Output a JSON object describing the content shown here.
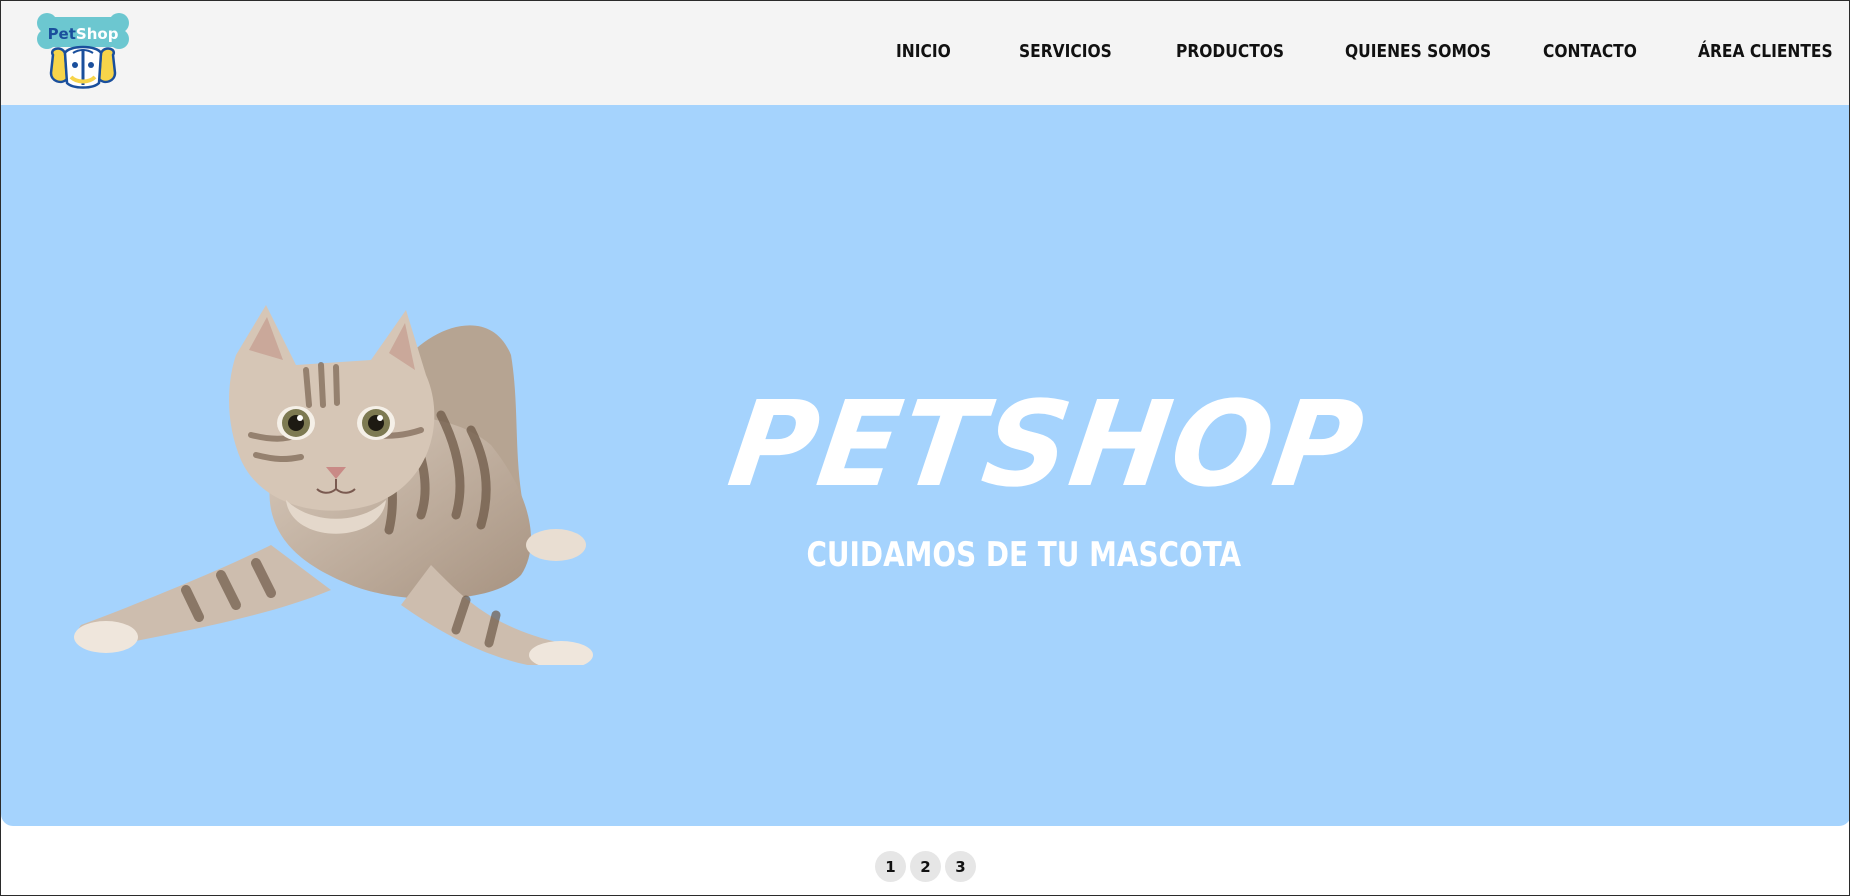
{
  "logo": {
    "text_pet": "Pet",
    "text_shop": "Shop",
    "icon": "petshop-logo-icon"
  },
  "nav": {
    "items": [
      {
        "label": "INICIO"
      },
      {
        "label": "SERVICIOS"
      },
      {
        "label": "PRODUCTOS"
      },
      {
        "label": "QUIENES SOMOS"
      },
      {
        "label": "CONTACTO"
      },
      {
        "label": "ÁREA CLIENTES"
      }
    ]
  },
  "hero": {
    "title": "PETSHOP",
    "subtitle": "CUIDAMOS DE TU MASCOTA",
    "image": "kitten-photo",
    "background_color": "#a5d3fd"
  },
  "pager": {
    "pages": [
      "1",
      "2",
      "3"
    ]
  },
  "colors": {
    "header_bg": "#f4f4f4",
    "hero_bg": "#a5d3fd",
    "text_dark": "#111111",
    "pager_bg": "#e6e6e6",
    "logo_teal": "#6cc7d0",
    "logo_navy": "#1a4f9c",
    "logo_yellow": "#f7d44a"
  }
}
